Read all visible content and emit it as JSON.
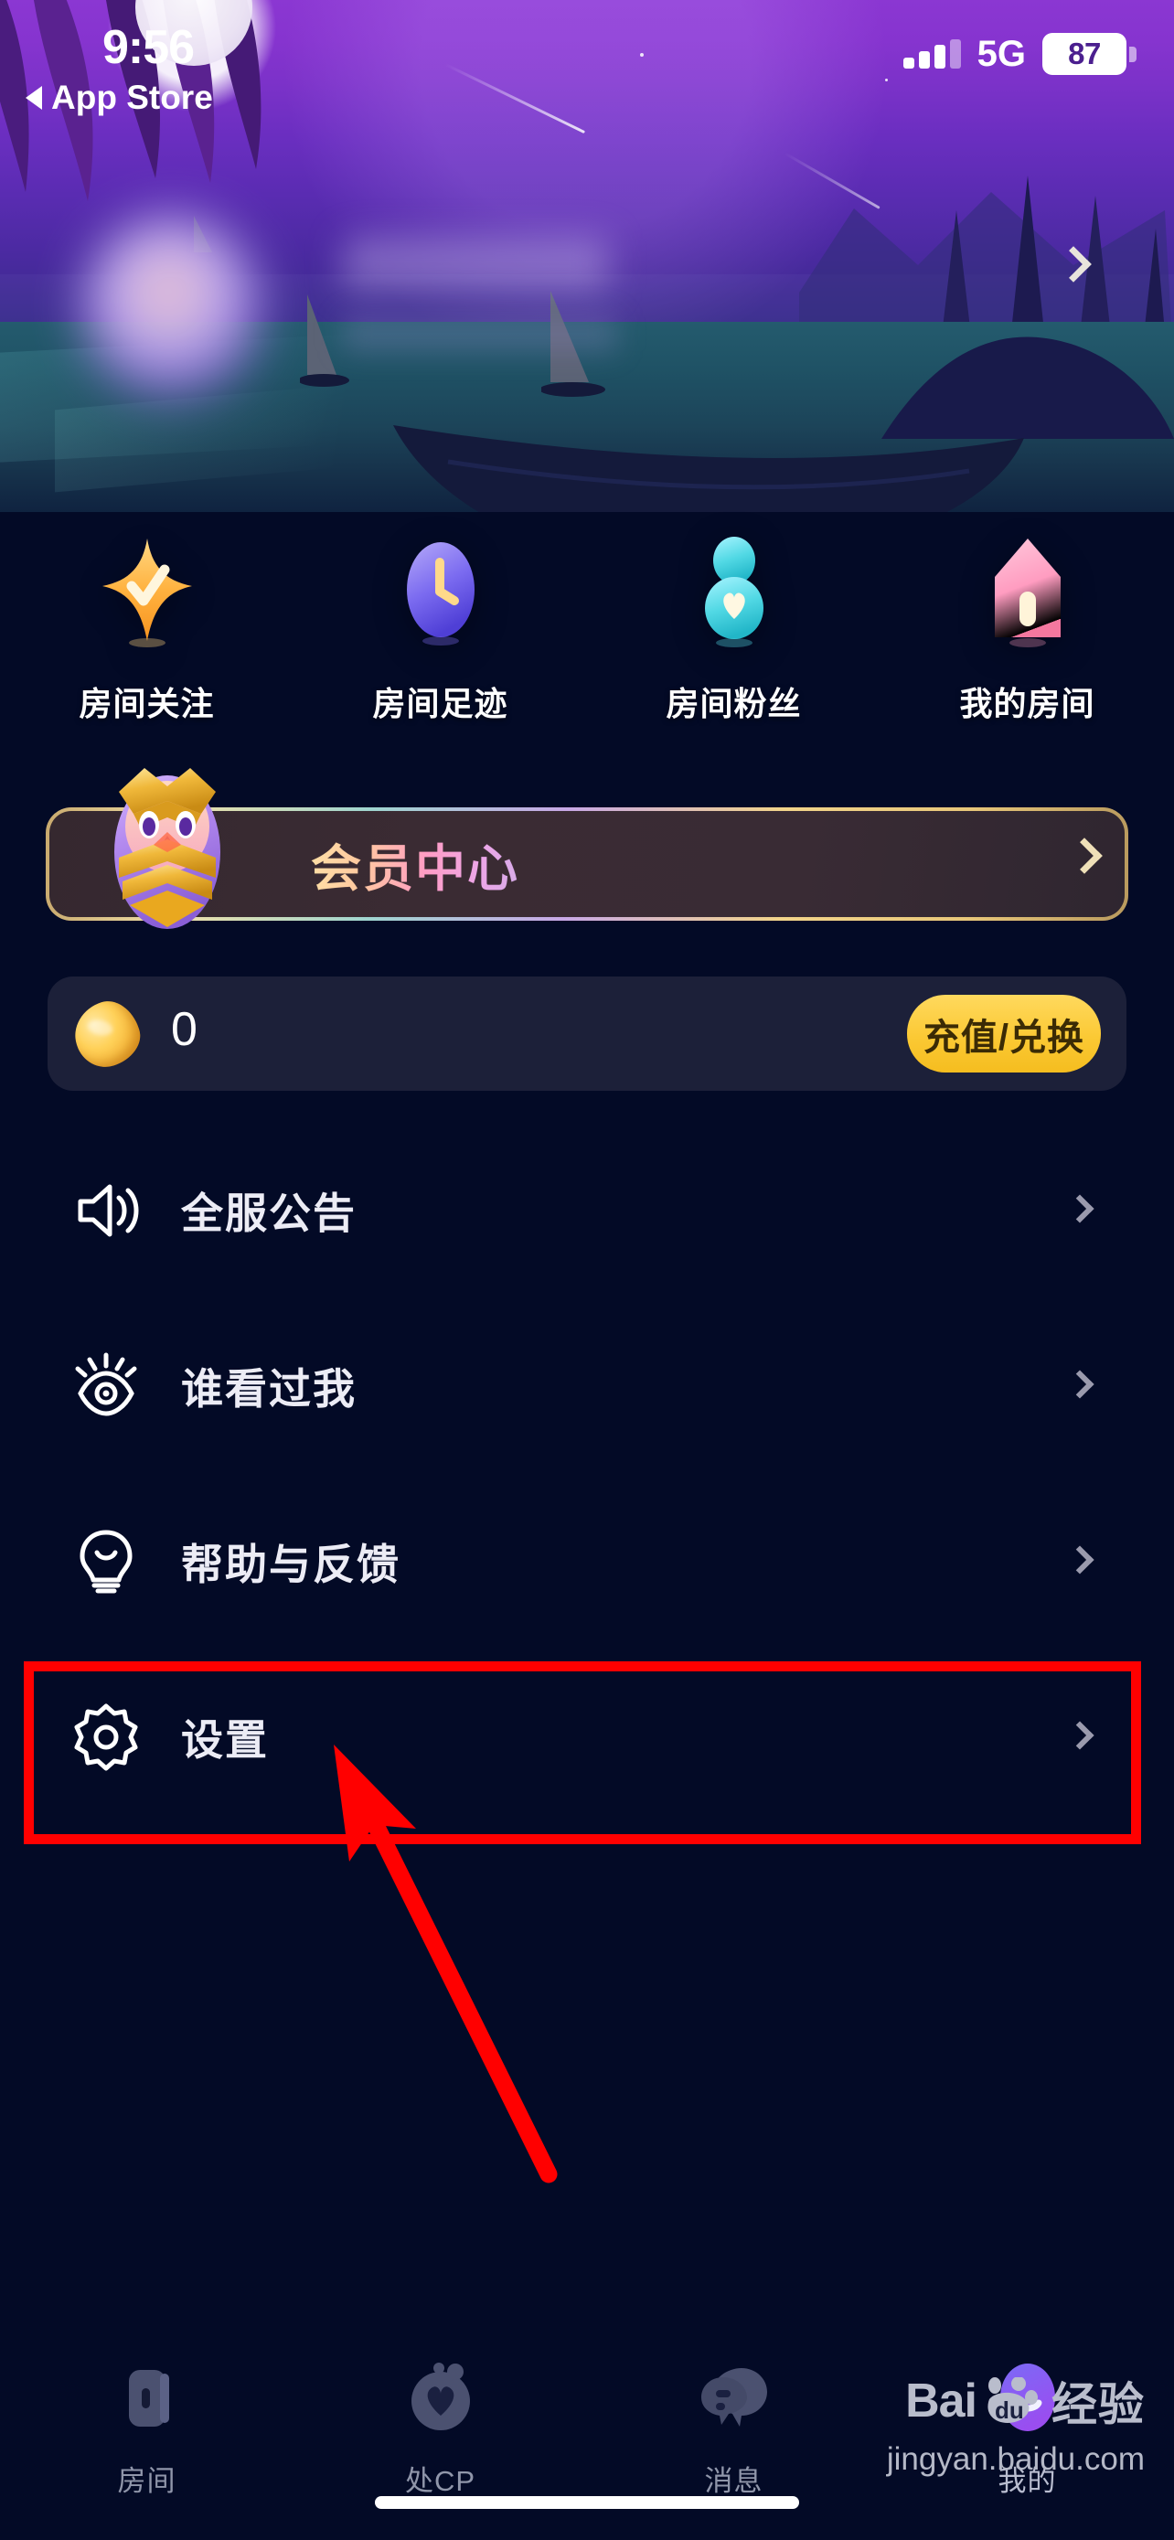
{
  "status_bar": {
    "time": "9:56",
    "back_label": "App Store",
    "network": "5G",
    "battery": "87",
    "signal_icon": "signal-bars-icon",
    "battery_icon": "battery-icon"
  },
  "profile": {
    "avatar_icon": "avatar-blurred",
    "name": "",
    "subtitle": "",
    "chevron_icon": "chevron-right-icon"
  },
  "shortcuts": [
    {
      "label": "房间关注",
      "icon": "star-check-icon",
      "color": "#ffb347"
    },
    {
      "label": "房间足迹",
      "icon": "clock-icon",
      "color": "#7b6bf0"
    },
    {
      "label": "房间粉丝",
      "icon": "person-heart-icon",
      "color": "#5fe0e8"
    },
    {
      "label": "我的房间",
      "icon": "house-icon",
      "color": "#ff9ec0"
    }
  ],
  "vip_banner": {
    "title": "会员中心",
    "mascot_icon": "vip-crown-mascot-icon",
    "chevron_icon": "chevron-right-icon"
  },
  "wallet": {
    "coin_icon": "gold-coin-icon",
    "balance": "0",
    "recharge_label": "充值/兑换",
    "recharge_color": "#fbc934"
  },
  "menu": [
    {
      "label": "全服公告",
      "icon": "megaphone-icon",
      "chevron": "chevron-right-icon"
    },
    {
      "label": "谁看过我",
      "icon": "eye-icon",
      "chevron": "chevron-right-icon"
    },
    {
      "label": "帮助与反馈",
      "icon": "lightbulb-icon",
      "chevron": "chevron-right-icon"
    },
    {
      "label": "设置",
      "icon": "gear-icon",
      "chevron": "chevron-right-icon"
    }
  ],
  "annotation": {
    "highlight_color": "#ff0000",
    "target_label": "设置",
    "arrow_icon": "pointer-arrow-icon"
  },
  "tabs": [
    {
      "label": "房间",
      "icon": "room-icon",
      "active": false
    },
    {
      "label": "处CP",
      "icon": "cp-heart-icon",
      "active": false
    },
    {
      "label": "消息",
      "icon": "chat-bubble-icon",
      "active": false
    },
    {
      "label": "我的",
      "icon": "profile-avatar-icon",
      "active": true
    }
  ],
  "watermark": {
    "brand": "Bai",
    "brand_suffix": "du",
    "product": "经验",
    "url": "jingyan.baidu.com"
  }
}
